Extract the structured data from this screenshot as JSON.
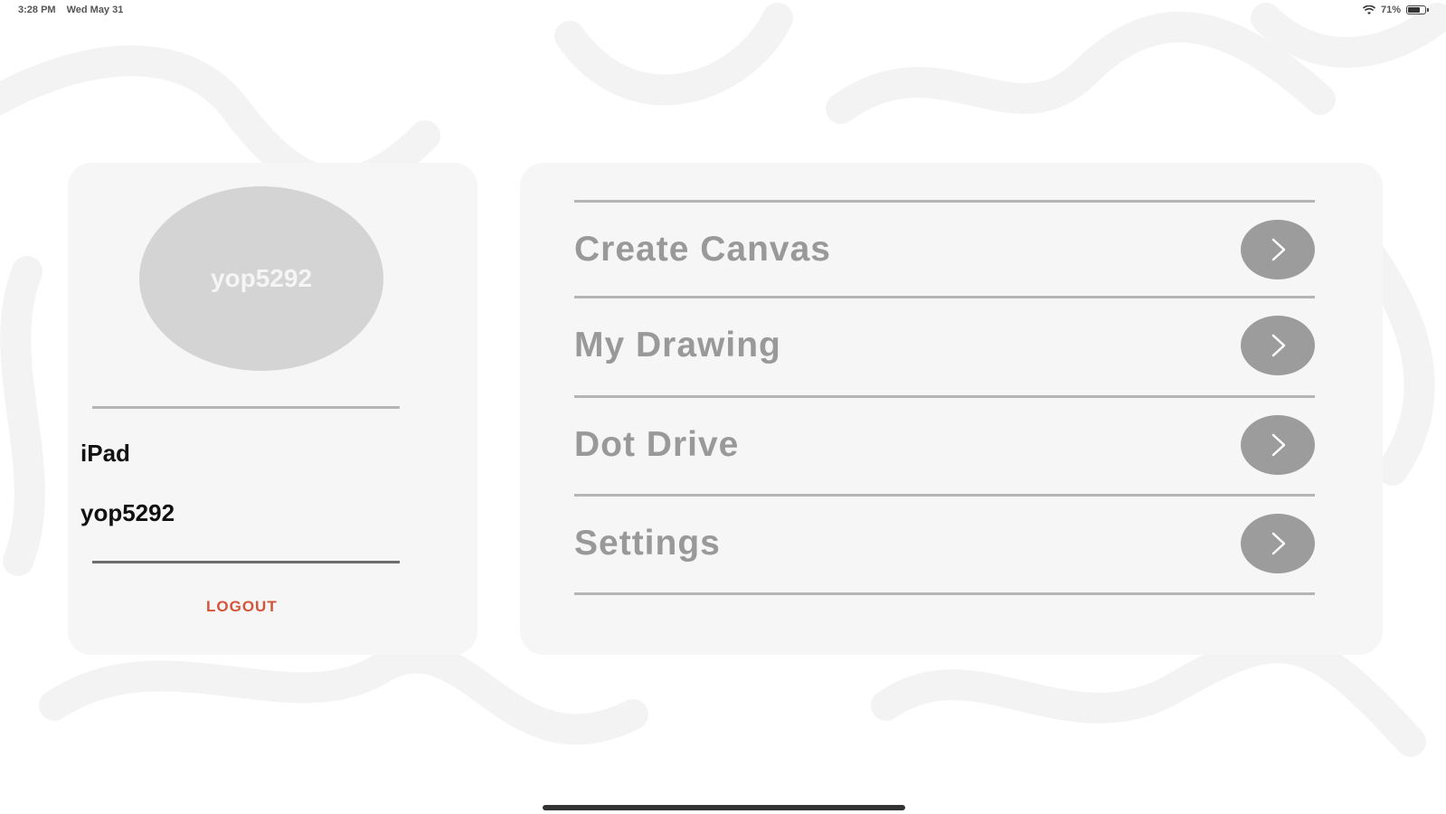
{
  "status_bar": {
    "time": "3:28 PM",
    "date": "Wed May 31",
    "battery": "71%",
    "battery_level": 0.71
  },
  "profile": {
    "avatar_text": "yop5292",
    "device_name": "iPad",
    "username": "yop5292",
    "logout_label": "LOGOUT"
  },
  "menu": {
    "items": [
      {
        "label": "Create Canvas",
        "icon": "chevron-right-icon"
      },
      {
        "label": "My Drawing",
        "icon": "chevron-right-icon"
      },
      {
        "label": "Dot Drive",
        "icon": "chevron-right-icon"
      },
      {
        "label": "Settings",
        "icon": "chevron-right-icon"
      }
    ]
  },
  "colors": {
    "logout": "#d4543a",
    "menu_text": "#999999",
    "panel": "#f6f6f6"
  }
}
